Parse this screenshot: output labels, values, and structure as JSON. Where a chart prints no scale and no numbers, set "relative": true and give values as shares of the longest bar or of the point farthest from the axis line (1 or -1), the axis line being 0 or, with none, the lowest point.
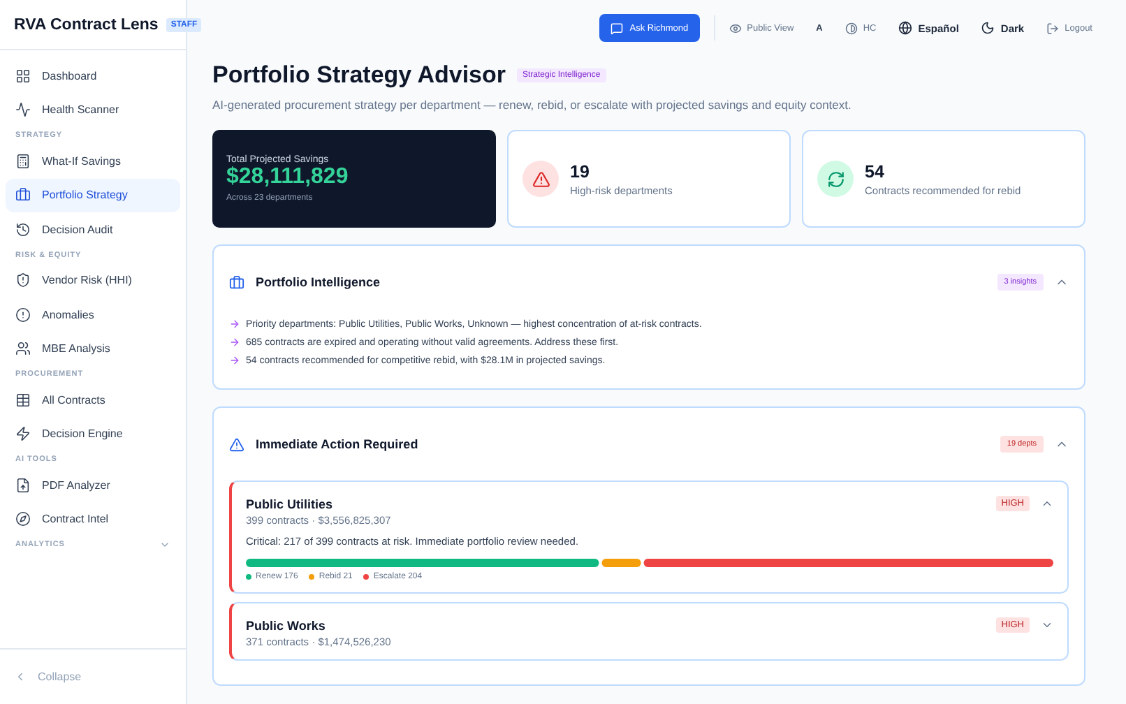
{
  "sidebar": {
    "brand": "RVA Contract Lens",
    "badge": "STAFF",
    "items": [
      {
        "kind": "item",
        "label": "Dashboard",
        "selected": false
      },
      {
        "kind": "item",
        "label": "Health Scanner",
        "selected": false
      },
      {
        "kind": "section",
        "label": "STRATEGY"
      },
      {
        "kind": "item",
        "label": "What-If Savings",
        "selected": false
      },
      {
        "kind": "item",
        "label": "Portfolio Strategy",
        "selected": true
      },
      {
        "kind": "item",
        "label": "Decision Audit",
        "selected": false
      },
      {
        "kind": "section",
        "label": "RISK & EQUITY"
      },
      {
        "kind": "item",
        "label": "Vendor Risk (HHI)",
        "selected": false
      },
      {
        "kind": "item",
        "label": "Anomalies",
        "selected": false
      },
      {
        "kind": "item",
        "label": "MBE Analysis",
        "selected": false
      },
      {
        "kind": "section",
        "label": "PROCUREMENT"
      },
      {
        "kind": "item",
        "label": "All Contracts",
        "selected": false
      },
      {
        "kind": "item",
        "label": "Decision Engine",
        "selected": false
      },
      {
        "kind": "section",
        "label": "AI TOOLS"
      },
      {
        "kind": "item",
        "label": "PDF Analyzer",
        "selected": false
      },
      {
        "kind": "item",
        "label": "Contract Intel",
        "selected": false
      },
      {
        "kind": "section",
        "label": "ANALYTICS",
        "expanded": false
      }
    ],
    "collapse": "Collapse"
  },
  "topbar": {
    "ask": "Ask Richmond",
    "public_view": "Public View",
    "font_size": "A",
    "contrast": "HC",
    "language": "Español",
    "theme": "Dark",
    "logout": "Logout"
  },
  "page": {
    "title": "Portfolio Strategy Advisor",
    "tag": "Strategic Intelligence",
    "subtitle": "AI-generated procurement strategy per department — renew, rebid, or escalate with projected savings and equity context."
  },
  "stats": [
    {
      "kind": "total",
      "label": "Total Projected Savings",
      "value": "$28,111,829",
      "note": "Across 23 departments"
    },
    {
      "kind": "risk",
      "value": "19",
      "label": "High-risk departments"
    },
    {
      "kind": "rebid",
      "value": "54",
      "label": "Contracts recommended for rebid"
    }
  ],
  "intelligence": {
    "title": "Portfolio Intelligence",
    "badge": "3 insights",
    "expanded": true,
    "insights": [
      "Priority departments: Public Utilities, Public Works, Unknown — highest concentration of at-risk contracts.",
      "685 contracts are expired and operating without valid agreements. Address these first.",
      "54 contracts recommended for competitive rebid, with $28.1M in projected savings."
    ]
  },
  "action": {
    "title": "Immediate Action Required",
    "badge": "19 depts",
    "expanded": true,
    "departments": [
      {
        "name": "Public Utilities",
        "meta": "399 contracts · $3,556,825,307",
        "risk": "HIGH",
        "expanded": true,
        "note": "Critical: 217 of 399 contracts at risk. Immediate portfolio review needed.",
        "chart_data": {
          "type": "bar",
          "orientation": "horizontal",
          "stacked": true,
          "legend": "bottom",
          "relative": true,
          "series": [
            {
              "name": "Renew 176",
              "color": "#10b981",
              "values": [
                0.439
              ]
            },
            {
              "name": "Rebid 21",
              "color": "#f59e0b",
              "values": [
                0.052
              ]
            },
            {
              "name": "Escalate 204",
              "color": "#ef4444",
              "values": [
                0.509
              ]
            }
          ]
        }
      },
      {
        "name": "Public Works",
        "meta": "371 contracts · $1,474,526,230",
        "risk": "HIGH",
        "expanded": false
      }
    ]
  }
}
